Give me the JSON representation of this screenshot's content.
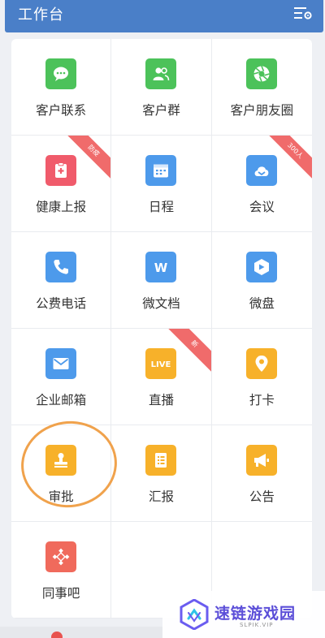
{
  "header": {
    "title": "工作台",
    "menu_icon": "filter-settings-icon"
  },
  "colors": {
    "header": "#4a7fc8",
    "green": "#4cc25a",
    "blue": "#4d9aeb",
    "red": "#f05b6b",
    "yellow": "#f7b12a",
    "coral": "#f06a5c",
    "ribbon": "#f06b6b",
    "annotation_circle": "#f0a24c"
  },
  "apps": [
    {
      "key": "customer-contact",
      "label": "客户联系",
      "icon": "chat-bubble-icon",
      "color": "#4cc25a"
    },
    {
      "key": "customer-group",
      "label": "客户群",
      "icon": "group-contacts-icon",
      "color": "#4cc25a"
    },
    {
      "key": "customer-moments",
      "label": "客户朋友圈",
      "icon": "aperture-icon",
      "color": "#4cc25a"
    },
    {
      "key": "health-report",
      "label": "健康上报",
      "icon": "clipboard-plus-icon",
      "color": "#f05b6b",
      "ribbon": "防疫"
    },
    {
      "key": "schedule",
      "label": "日程",
      "icon": "calendar-icon",
      "color": "#4d9aeb"
    },
    {
      "key": "meeting",
      "label": "会议",
      "icon": "cloud-icon",
      "color": "#4d9aeb",
      "ribbon": "300人"
    },
    {
      "key": "public-phone",
      "label": "公费电话",
      "icon": "phone-icon",
      "color": "#4d9aeb"
    },
    {
      "key": "docs",
      "label": "微文档",
      "icon": "document-w-icon",
      "color": "#4d9aeb"
    },
    {
      "key": "drive",
      "label": "微盘",
      "icon": "drive-icon",
      "color": "#4d9aeb"
    },
    {
      "key": "mail",
      "label": "企业邮箱",
      "icon": "envelope-icon",
      "color": "#4d9aeb"
    },
    {
      "key": "live",
      "label": "直播",
      "icon": "live-icon",
      "color": "#f7b12a",
      "ribbon": "新",
      "icon_text": "LIVE"
    },
    {
      "key": "checkin",
      "label": "打卡",
      "icon": "location-pin-icon",
      "color": "#f7b12a"
    },
    {
      "key": "approval",
      "label": "审批",
      "icon": "stamp-icon",
      "color": "#f7b12a"
    },
    {
      "key": "report",
      "label": "汇报",
      "icon": "report-list-icon",
      "color": "#f7b12a"
    },
    {
      "key": "announcement",
      "label": "公告",
      "icon": "megaphone-icon",
      "color": "#f7b12a"
    },
    {
      "key": "colleague-bar",
      "label": "同事吧",
      "icon": "diamond-dots-icon",
      "color": "#f06a5c"
    }
  ],
  "watermark": {
    "text": "速链游戏园",
    "sub": "SLPIK.VIP",
    "logo": "watermark-logo-icon"
  }
}
